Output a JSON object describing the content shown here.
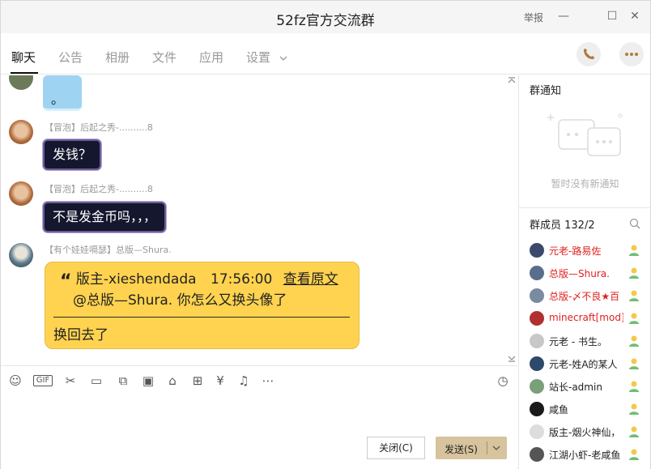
{
  "window": {
    "title": "52fz官方交流群",
    "report_label": "举报",
    "minimize": "—",
    "maximize": "☐",
    "close": "✕"
  },
  "tabs": [
    {
      "label": "聊天",
      "active": true
    },
    {
      "label": "公告",
      "active": false
    },
    {
      "label": "相册",
      "active": false
    },
    {
      "label": "文件",
      "active": false
    },
    {
      "label": "应用",
      "active": false
    },
    {
      "label": "设置",
      "active": false
    }
  ],
  "messages": {
    "first_bubble_text": "。",
    "msg1": {
      "sender": "【冒泡】后起之秀-..........8",
      "text": "发钱？"
    },
    "msg2": {
      "sender": "【冒泡】后起之秀-..........8",
      "text": "不是发金币吗，，，"
    },
    "msg3": {
      "sender": "【有个娃娃嗝瑟】总版—Shura.",
      "quote_mark": "“",
      "quote_author": "版主-xieshendada",
      "quote_time": "17:56:00",
      "quote_link": "查看原文",
      "quote_text": "@总版—Shura. 你怎么又换头像了",
      "reply": "换回去了"
    }
  },
  "buttons": {
    "close_label": "关闭(C)",
    "send_label": "发送(S)"
  },
  "sidebar": {
    "notice_title": "群通知",
    "notice_empty": "暂时没有新通知",
    "members_title": "群成员 132/2",
    "members": [
      {
        "name": "元老-路易佐",
        "color": "#e02020",
        "avatar": "#3b4a6b"
      },
      {
        "name": "总版—Shura.",
        "color": "#e02020",
        "avatar": "#5a6d8a"
      },
      {
        "name": "总版-〆不良★百",
        "color": "#e02020",
        "avatar": "#7a8aa0"
      },
      {
        "name": "minecraft[mod]",
        "color": "#e02020",
        "avatar": "#b03030"
      },
      {
        "name": "元老 - 书生。",
        "color": "#222222",
        "avatar": "#c8c8c8"
      },
      {
        "name": "元老-姓A的某人",
        "color": "#222222",
        "avatar": "#2e4a6a"
      },
      {
        "name": "站长-admin",
        "color": "#222222",
        "avatar": "#7aa07a"
      },
      {
        "name": "咸鱼",
        "color": "#222222",
        "avatar": "#1a1a1a"
      },
      {
        "name": "版主-烟火神仙，",
        "color": "#222222",
        "avatar": "#dddddd"
      },
      {
        "name": "江湖小虾-老咸鱼",
        "color": "#222222",
        "avatar": "#555555"
      }
    ]
  }
}
